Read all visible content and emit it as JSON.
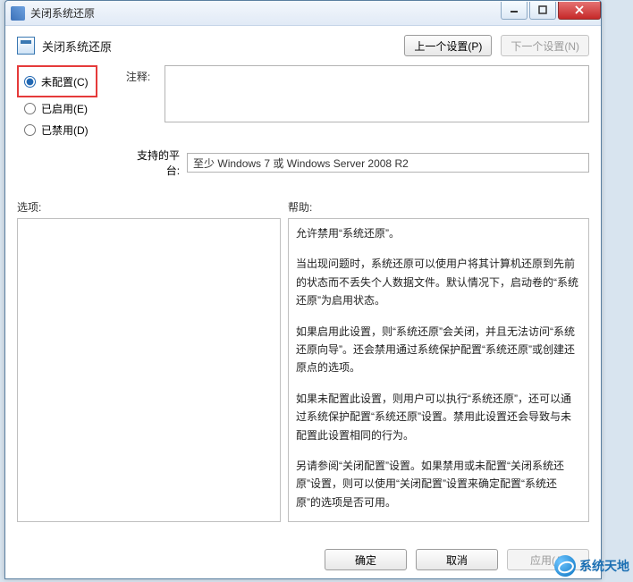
{
  "window": {
    "title": "关闭系统还原"
  },
  "header": {
    "title": "关闭系统还原",
    "prev_btn": "上一个设置(P)",
    "next_btn": "下一个设置(N)"
  },
  "radios": {
    "not_configured": "未配置(C)",
    "enabled": "已启用(E)",
    "disabled": "已禁用(D)",
    "selected": "not_configured"
  },
  "labels": {
    "comment": "注释:",
    "platform": "支持的平台:",
    "options": "选项:",
    "help": "帮助:"
  },
  "fields": {
    "comment_value": "",
    "platform_value": "至少 Windows 7 或 Windows Server 2008 R2"
  },
  "help_paragraphs": [
    "允许禁用“系统还原”。",
    "当出现问题时，系统还原可以使用户将其计算机还原到先前的状态而不丢失个人数据文件。默认情况下，启动卷的“系统还原”为启用状态。",
    "如果启用此设置，则“系统还原”会关闭，并且无法访问“系统还原向导”。还会禁用通过系统保护配置“系统还原”或创建还原点的选项。",
    "如果未配置此设置，则用户可以执行“系统还原”，还可以通过系统保护配置“系统还原”设置。禁用此设置还会导致与未配置此设置相同的行为。",
    "另请参阅“关闭配置”设置。如果禁用或未配置“关闭系统还原”设置，则可以使用“关闭配置”设置来确定配置“系统还原”的选项是否可用。"
  ],
  "footer": {
    "ok": "确定",
    "cancel": "取消",
    "apply": "应用(A)"
  },
  "watermark": "系统天地"
}
